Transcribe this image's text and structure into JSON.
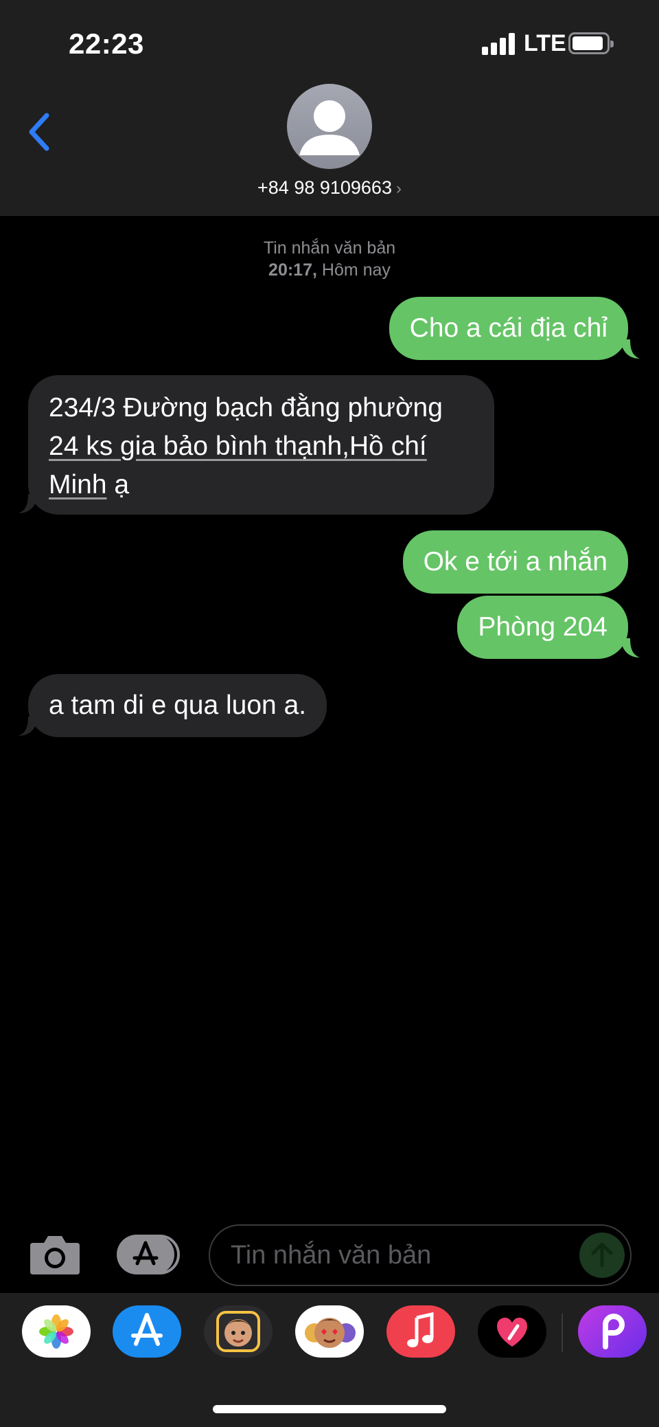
{
  "status": {
    "time": "22:23",
    "network": "LTE"
  },
  "header": {
    "contact": "+84 98 9109663",
    "chevron": "›",
    "back_icon": "chevron-left-icon"
  },
  "conversation": {
    "kind": "Tin nhắn văn bản",
    "timestamp_prefix": "20:17,",
    "timestamp_day": "Hôm nay",
    "messages": [
      {
        "direction": "sent",
        "text": "Cho a cái địa chỉ"
      },
      {
        "direction": "received",
        "parts": [
          "234/3 Đường bạch đằng phường",
          "24 ks gia bảo bình thạnh,",
          "Hồ chí",
          "Minh",
          " ạ"
        ]
      },
      {
        "direction": "sent",
        "text": "Ok e tới a nhắn"
      },
      {
        "direction": "sent",
        "text": "Phòng 204"
      },
      {
        "direction": "received",
        "text": "a tam di e qua luon a."
      }
    ]
  },
  "composer": {
    "placeholder": "Tin nhắn văn bản"
  },
  "apps": [
    {
      "name": "photos-app-icon",
      "bg": "#ffffff"
    },
    {
      "name": "app-store-icon",
      "bg": "#1a8cf0"
    },
    {
      "name": "memoji-stickers-icon",
      "bg": "#2c2c2e"
    },
    {
      "name": "animoji-icon",
      "bg": "#ffffff"
    },
    {
      "name": "music-app-icon",
      "bg": "#f0404e"
    },
    {
      "name": "digital-touch-icon",
      "bg": "#000000"
    },
    {
      "name": "picsart-app-icon",
      "bg": "#8a3cf0"
    }
  ],
  "colors": {
    "sent_bubble": "#65c466",
    "received_bubble": "#262628",
    "accent": "#2f7cf6"
  }
}
